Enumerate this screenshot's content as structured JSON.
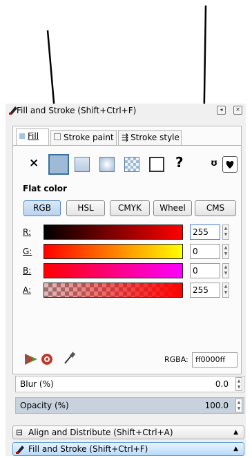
{
  "dialog": {
    "title": "Fill and Stroke (Shift+Ctrl+F)"
  },
  "tabs": [
    {
      "label": "Fill",
      "active": true
    },
    {
      "label": "Stroke paint",
      "active": false
    },
    {
      "label": "Stroke style",
      "active": false
    }
  ],
  "paint_types": [
    "none",
    "flat-color",
    "linear-gradient",
    "radial-gradient",
    "pattern",
    "swatch",
    "unset"
  ],
  "selected_paint": "flat-color",
  "section_label": "Flat color",
  "color_modes": [
    {
      "label": "RGB",
      "active": true
    },
    {
      "label": "HSL",
      "active": false
    },
    {
      "label": "CMYK",
      "active": false
    },
    {
      "label": "Wheel",
      "active": false
    },
    {
      "label": "CMS",
      "active": false
    }
  ],
  "channels": [
    {
      "label": "R:",
      "value": "255"
    },
    {
      "label": "G:",
      "value": "0"
    },
    {
      "label": "B:",
      "value": "0"
    },
    {
      "label": "A:",
      "value": "255"
    }
  ],
  "rgba": {
    "label": "RGBA:",
    "value": "ff0000ff"
  },
  "blur": {
    "label": "Blur (%)",
    "value": "0.0"
  },
  "opacity": {
    "label": "Opacity (%)",
    "value": "100.0"
  },
  "docks": [
    {
      "label": "Align and Distribute (Shift+Ctrl+A)"
    },
    {
      "label": "Fill and Stroke (Shift+Ctrl+F)"
    }
  ],
  "colors": {
    "accent": "#4f86c2",
    "current_fill": "#ff0000"
  }
}
